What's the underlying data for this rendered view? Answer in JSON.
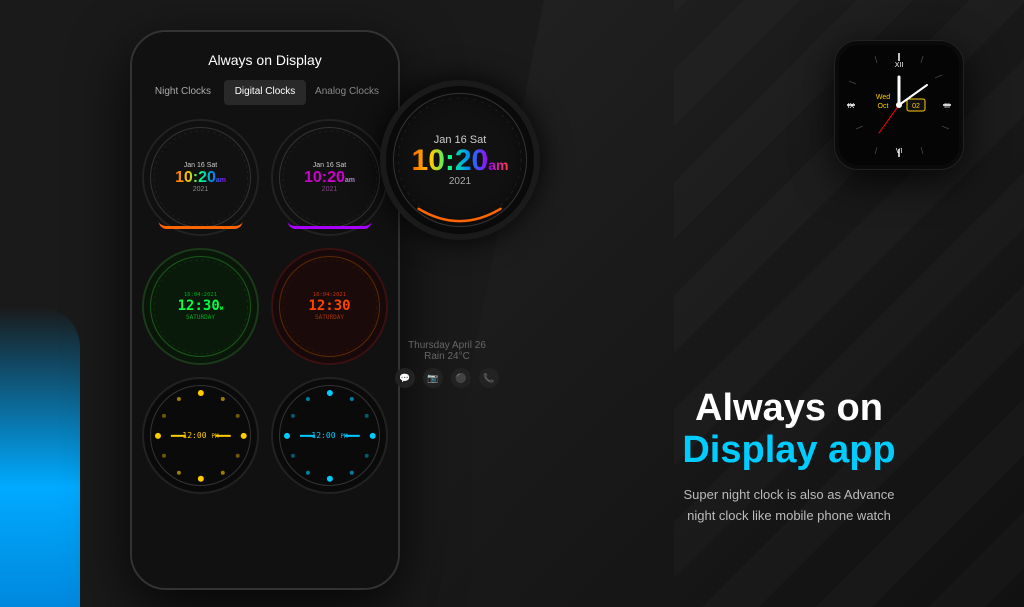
{
  "app": {
    "title": "Always on Display"
  },
  "tabs": [
    {
      "label": "Night Clocks",
      "active": false
    },
    {
      "label": "Digital Clocks",
      "active": true
    },
    {
      "label": "Analog Clocks",
      "active": false
    }
  ],
  "clocks": [
    {
      "id": "clock-1",
      "date": "Jan 16 Sat",
      "time": "10:20",
      "ampm": "am",
      "year": "2021",
      "style": "rainbow"
    },
    {
      "id": "clock-2",
      "date": "Jan 16 Sat",
      "time": "10:20",
      "ampm": "am",
      "year": "2021",
      "style": "purple"
    },
    {
      "id": "clock-3",
      "date": "16:04:2021",
      "time": "12:30",
      "day": "SATURDAY",
      "style": "green-digital"
    },
    {
      "id": "clock-4",
      "date": "16:04:2021",
      "time": "12:30",
      "day": "SATURDAY",
      "style": "orange-digital"
    },
    {
      "id": "clock-5",
      "time": "12:00",
      "ampm": "PM",
      "style": "dots-yellow"
    },
    {
      "id": "clock-6",
      "time": "12:00",
      "ampm": "PM",
      "style": "dots-cyan"
    }
  ],
  "bigClock": {
    "date": "Jan 16 Sat",
    "time": "10:20",
    "ampm": "am",
    "year": "2021"
  },
  "weatherInfo": {
    "line1": "Thursday April 26",
    "line2": "Rain 24°C"
  },
  "analogWatch": {
    "day": "Wed",
    "date": "Oct",
    "number": "02"
  },
  "heading": {
    "line1": "Always on",
    "line2": "Display app"
  },
  "subtext": "Super night clock is also as Advance\nnight clock like mobile phone watch"
}
